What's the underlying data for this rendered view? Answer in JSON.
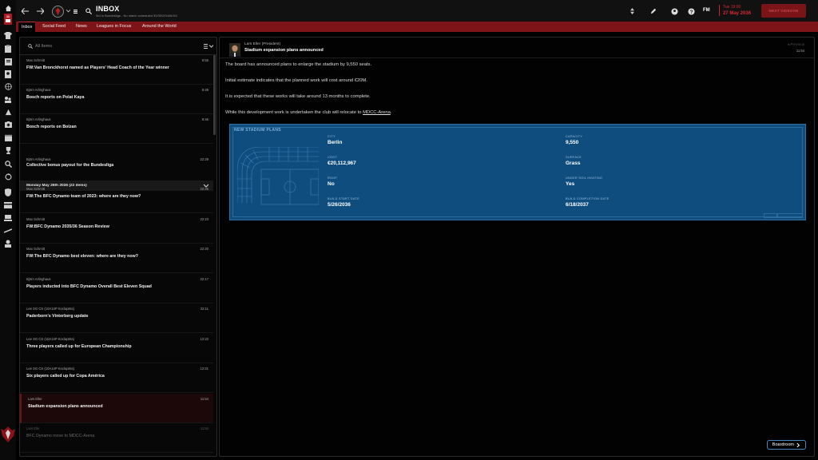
{
  "sidebar": {
    "inbox_badge": "11"
  },
  "topbar": {
    "title": "INBOX",
    "subtitle": "3rd in Bundesliga - No match scheduled  30/30/2/0/4/8/4/1",
    "fm_label": "FM",
    "date_line1": "Tue 19:00",
    "date_line2": "27 May 2036",
    "continue_label": "NEXT VIDEO/IN"
  },
  "tabs": [
    "Inbox",
    "Social Feed",
    "News",
    "Leagues in Focus",
    "Around the World"
  ],
  "inbox": {
    "search_placeholder": "All Items",
    "day_header": "Monday May 26th 2036 (22 items)",
    "messages": [
      {
        "from": "Max Schmitt",
        "time": "8:55",
        "subject": "FW:Van Bronckhorst named as Players' Head Coach of the Year winner"
      },
      {
        "from": "Björn Arlinghaus",
        "time": "8:49",
        "subject": "Bosch reports on Polat Kaya"
      },
      {
        "from": "Björn Arlinghaus",
        "time": "8:46",
        "subject": "Bosch reports on Bolzan"
      },
      {
        "from": "Björn Arlinghaus",
        "time": "22:29",
        "subject": "Collective bonus payout for the Bundesliga"
      },
      {
        "from": "Max Schmitt",
        "time": "22:26",
        "subject": "FW:The BFC Dynamo team of 2023: where are they now?"
      },
      {
        "from": "Max Schmitt",
        "time": "22:23",
        "subject": "FW:BFC Dynamo 2035/36 Season Review"
      },
      {
        "from": "Max Schmitt",
        "time": "22:20",
        "subject": "FW:The BFC Dynamo best eleven: where are they now?"
      },
      {
        "from": "Björn Arlinghaus",
        "time": "22:17",
        "subject": "Players inducted into BFC Dynamo Overall Best Eleven Squad"
      },
      {
        "from": "Lee SG CS (10A14P Koclap8ra)",
        "time": "22:11",
        "subject": "Paderborn's Vinterberg update"
      },
      {
        "from": "Lee SG CS (10A14P Koclap8ra)",
        "time": "12:22",
        "subject": "Three players called up for European Championship"
      },
      {
        "from": "Lee SG CS (10A14P Koclap8ra)",
        "time": "12:21",
        "subject": "Six players called up for Copa América"
      },
      {
        "from": "Lars Eller",
        "time": "11:54",
        "subject": "Stadium expansion plans announced"
      },
      {
        "from": "Lars Elle",
        "time": "11:54",
        "subject": "BFC Dynamo move to MDCC-Arena"
      }
    ]
  },
  "detail": {
    "from": "Lars Eller (President)",
    "subject": "Stadium expansion plans announced",
    "time": "11:54",
    "prev_label": "Previous",
    "paragraphs": [
      "The board has announced plans to enlarge the stadium by 9,550 seats.",
      "Initial estimate indicates that the planned work will cost around €20M.",
      "It is expected that these works will take around 13 months to complete."
    ],
    "relocate_text": "While this development work is undertaken the club will relocate to ",
    "relocate_venue": "MDCC-Arena",
    "relocate_end": ".",
    "card": {
      "title": "NEW STADIUM PLANS",
      "fields": [
        {
          "label": "CITY",
          "value": "Berlin"
        },
        {
          "label": "CAPACITY",
          "value": "9,550"
        },
        {
          "label": "COST",
          "value": "€20,112,967"
        },
        {
          "label": "SURFACE",
          "value": "Grass"
        },
        {
          "label": "ROOF",
          "value": "No"
        },
        {
          "label": "UNDER SOIL HEATING",
          "value": "Yes"
        },
        {
          "label": "BUILD START DATE",
          "value": "5/26/2036"
        },
        {
          "label": "BUILD COMPLETION DATE",
          "value": "6/18/2037"
        }
      ]
    },
    "boardroom_label": "Boardroom"
  }
}
